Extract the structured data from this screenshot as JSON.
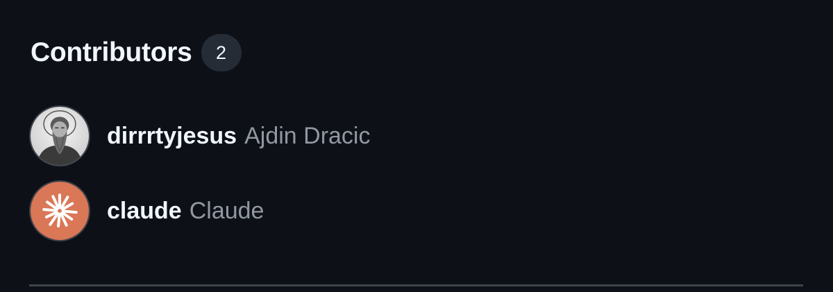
{
  "section": {
    "title": "Contributors",
    "count": "2"
  },
  "contributors": [
    {
      "login": "dirrrtyjesus",
      "name": "Ajdin Dracic",
      "avatar_icon": "bearded-man-photo-avatar"
    },
    {
      "login": "claude",
      "name": "Claude",
      "avatar_icon": "claude-starburst-logo",
      "avatar_color": "#d97757"
    }
  ],
  "colors": {
    "background": "#0d1117",
    "primary_text": "#f0f6fc",
    "secondary_text": "#9198a1",
    "counter_bg": "#262c36",
    "divider": "#3d444d"
  }
}
